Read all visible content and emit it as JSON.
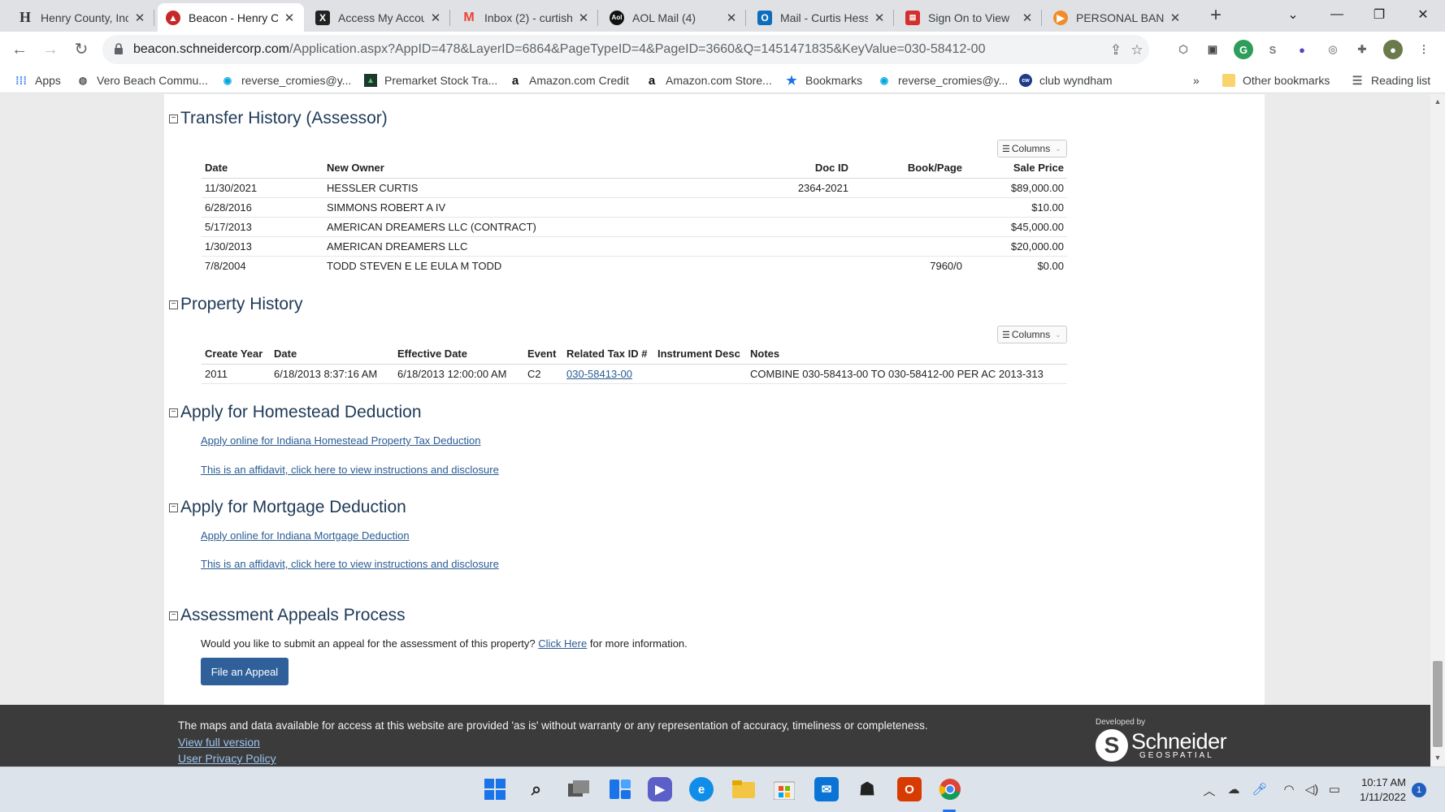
{
  "browser": {
    "tabs": [
      {
        "title": "Henry County, Inc",
        "icon": "henry-county-icon",
        "color": "#ffffff"
      },
      {
        "title": "Beacon - Henry C",
        "icon": "beacon-icon",
        "color": "#c62828"
      },
      {
        "title": "Access My Accou",
        "icon": "x-brand-icon",
        "color": "#222222"
      },
      {
        "title": "Inbox (2) - curtish",
        "icon": "gmail-icon",
        "color": "#ea4335"
      },
      {
        "title": "AOL Mail (4)",
        "icon": "aol-icon",
        "color": "#111111"
      },
      {
        "title": "Mail - Curtis Hess",
        "icon": "outlook-icon",
        "color": "#0f6cbd"
      },
      {
        "title": "Sign On to View",
        "icon": "bank-icon",
        "color": "#d32f2f"
      },
      {
        "title": "PERSONAL BANK",
        "icon": "personal-bank-icon",
        "color": "#f28c28"
      }
    ],
    "url_host": "beacon.schneidercorp.com",
    "url_path": "/Application.aspx?AppID=478&LayerID=6864&PageTypeID=4&PageID=3660&Q=1451471835&KeyValue=030-58412-00",
    "bookmarks": [
      {
        "label": "Apps",
        "icon": "apps-grid-icon"
      },
      {
        "label": "Vero Beach Commu...",
        "icon": "globe-icon"
      },
      {
        "label": "reverse_cromies@y...",
        "icon": "att-icon"
      },
      {
        "label": "Premarket Stock Tra...",
        "icon": "stock-icon"
      },
      {
        "label": "Amazon.com Credit",
        "icon": "amazon-icon"
      },
      {
        "label": "Amazon.com Store...",
        "icon": "amazon-icon"
      },
      {
        "label": "Bookmarks",
        "icon": "star-icon"
      },
      {
        "label": "reverse_cromies@y...",
        "icon": "att-icon"
      },
      {
        "label": "club wyndham",
        "icon": "wyndham-icon"
      }
    ],
    "more_bookmarks": "»",
    "other_bookmarks": "Other bookmarks",
    "reading_list": "Reading list"
  },
  "transfer": {
    "title": "Transfer History (Assessor)",
    "columns_btn": "Columns",
    "headers": [
      "Date",
      "New Owner",
      "Doc ID",
      "Book/Page",
      "Sale Price"
    ],
    "rows": [
      {
        "date": "11/30/2021",
        "owner": "HESSLER CURTIS",
        "doc": "2364-2021",
        "book": "",
        "price": "$89,000.00"
      },
      {
        "date": "6/28/2016",
        "owner": "SIMMONS ROBERT A IV",
        "doc": "",
        "book": "",
        "price": "$10.00"
      },
      {
        "date": "5/17/2013",
        "owner": "AMERICAN DREAMERS LLC (CONTRACT)",
        "doc": "",
        "book": "",
        "price": "$45,000.00"
      },
      {
        "date": "1/30/2013",
        "owner": "AMERICAN DREAMERS LLC",
        "doc": "",
        "book": "",
        "price": "$20,000.00"
      },
      {
        "date": "7/8/2004",
        "owner": "TODD STEVEN E LE EULA M TODD",
        "doc": "",
        "book": "7960/0",
        "price": "$0.00"
      }
    ]
  },
  "property": {
    "title": "Property History",
    "columns_btn": "Columns",
    "headers": [
      "Create Year",
      "Date",
      "Effective Date",
      "Event",
      "Related Tax ID #",
      "Instrument Desc",
      "Notes"
    ],
    "rows": [
      {
        "year": "2011",
        "date": "6/18/2013 8:37:16 AM",
        "effective": "6/18/2013 12:00:00 AM",
        "event": "C2",
        "taxid": "030-58413-00",
        "instrument": "",
        "notes": "COMBINE 030-58413-00 TO 030-58412-00 PER AC 2013-313"
      }
    ]
  },
  "homestead": {
    "title": "Apply for Homestead Deduction",
    "link1": "Apply online for Indiana Homestead Property Tax Deduction",
    "link2": "This is an affidavit, click here to view instructions and disclosure"
  },
  "mortgage": {
    "title": "Apply for Mortgage Deduction",
    "link1": "Apply online for Indiana Mortgage Deduction",
    "link2": "This is an affidavit, click here to view instructions and disclosure"
  },
  "appeals": {
    "title": "Assessment Appeals Process",
    "text_before": "Would you like to submit an appeal for the assessment of this property? ",
    "link": "Click Here",
    "text_after": " for more information.",
    "button": "File an Appeal"
  },
  "footer": {
    "disclaimer": "The maps and data available for access at this website are provided 'as is' without warranty or any representation of accuracy, timeliness or completeness.",
    "full_version": "View full version",
    "privacy": "User Privacy Policy",
    "developed_by": "Developed by",
    "brand": "Schneider",
    "brand_sub": "GEOSPATIAL"
  },
  "taskbar": {
    "time": "10:17 AM",
    "date": "1/11/2022",
    "notifications": "1"
  }
}
